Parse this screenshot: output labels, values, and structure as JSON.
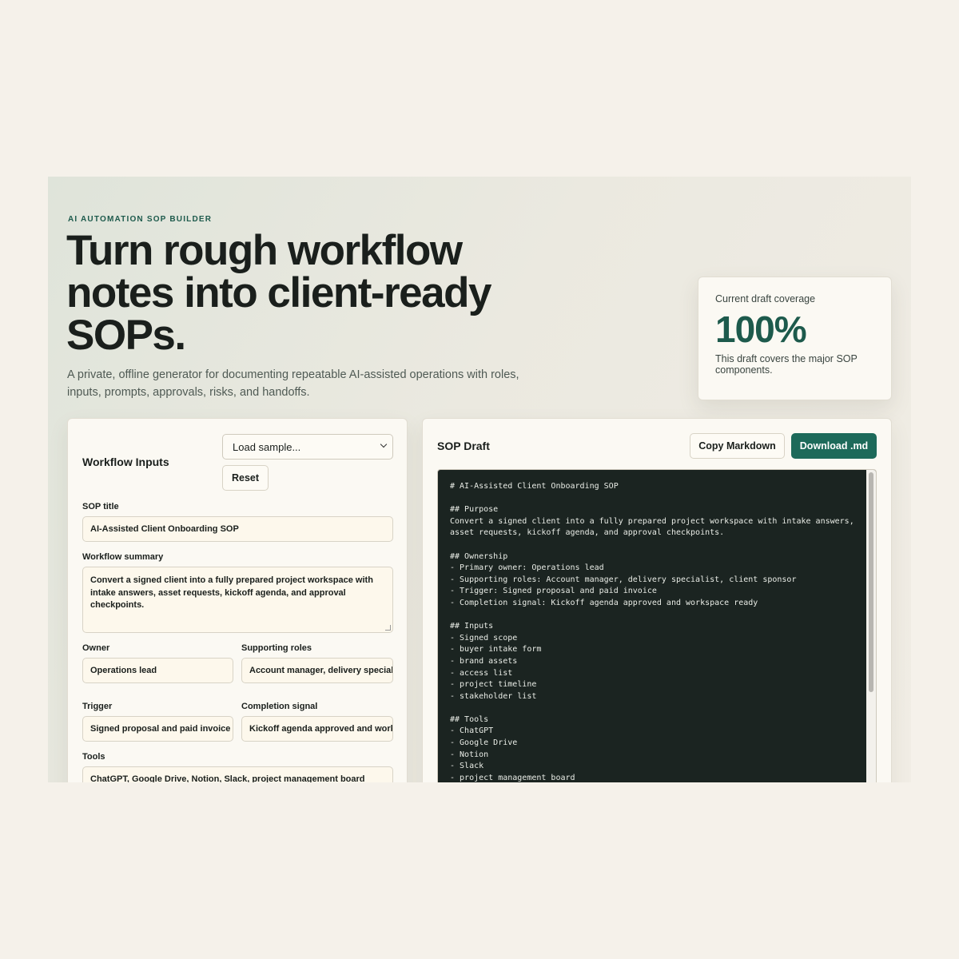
{
  "hero": {
    "eyebrow": "AI AUTOMATION SOP BUILDER",
    "title": "Turn rough workflow notes into client-ready SOPs.",
    "subtitle": "A private, offline generator for documenting repeatable AI-assisted operations with roles, inputs, prompts, approvals, risks, and handoffs."
  },
  "coverage": {
    "label": "Current draft coverage",
    "value": "100%",
    "description": "This draft covers the major SOP components."
  },
  "inputs_panel": {
    "title": "Workflow Inputs",
    "sample_select": "Load sample...",
    "reset_label": "Reset",
    "fields": {
      "sop_title": {
        "label": "SOP title",
        "value": "AI-Assisted Client Onboarding SOP"
      },
      "summary": {
        "label": "Workflow summary",
        "value": "Convert a signed client into a fully prepared project workspace with intake answers, asset requests, kickoff agenda, and approval checkpoints."
      },
      "owner": {
        "label": "Owner",
        "value": "Operations lead"
      },
      "supporting_roles": {
        "label": "Supporting roles",
        "value": "Account manager, delivery specialist, client sponsor"
      },
      "trigger": {
        "label": "Trigger",
        "value": "Signed proposal and paid invoice"
      },
      "completion": {
        "label": "Completion signal",
        "value": "Kickoff agenda approved and workspace ready"
      },
      "tools": {
        "label": "Tools",
        "value": "ChatGPT, Google Drive, Notion, Slack, project management board"
      }
    }
  },
  "draft_panel": {
    "title": "SOP Draft",
    "copy_label": "Copy Markdown",
    "download_label": "Download .md",
    "markdown": "# AI-Assisted Client Onboarding SOP\n\n## Purpose\nConvert a signed client into a fully prepared project workspace with intake answers, asset requests, kickoff agenda, and approval checkpoints.\n\n## Ownership\n- Primary owner: Operations lead\n- Supporting roles: Account manager, delivery specialist, client sponsor\n- Trigger: Signed proposal and paid invoice\n- Completion signal: Kickoff agenda approved and workspace ready\n\n## Inputs\n- Signed scope\n- buyer intake form\n- brand assets\n- access list\n- project timeline\n- stakeholder list\n\n## Tools\n- ChatGPT\n- Google Drive\n- Notion\n- Slack\n- project management board"
  },
  "colors": {
    "accent": "#1d6a5a",
    "accent_text": "#1d5a4c",
    "page_bg": "#f5f1ea",
    "code_bg": "#1b2421"
  }
}
